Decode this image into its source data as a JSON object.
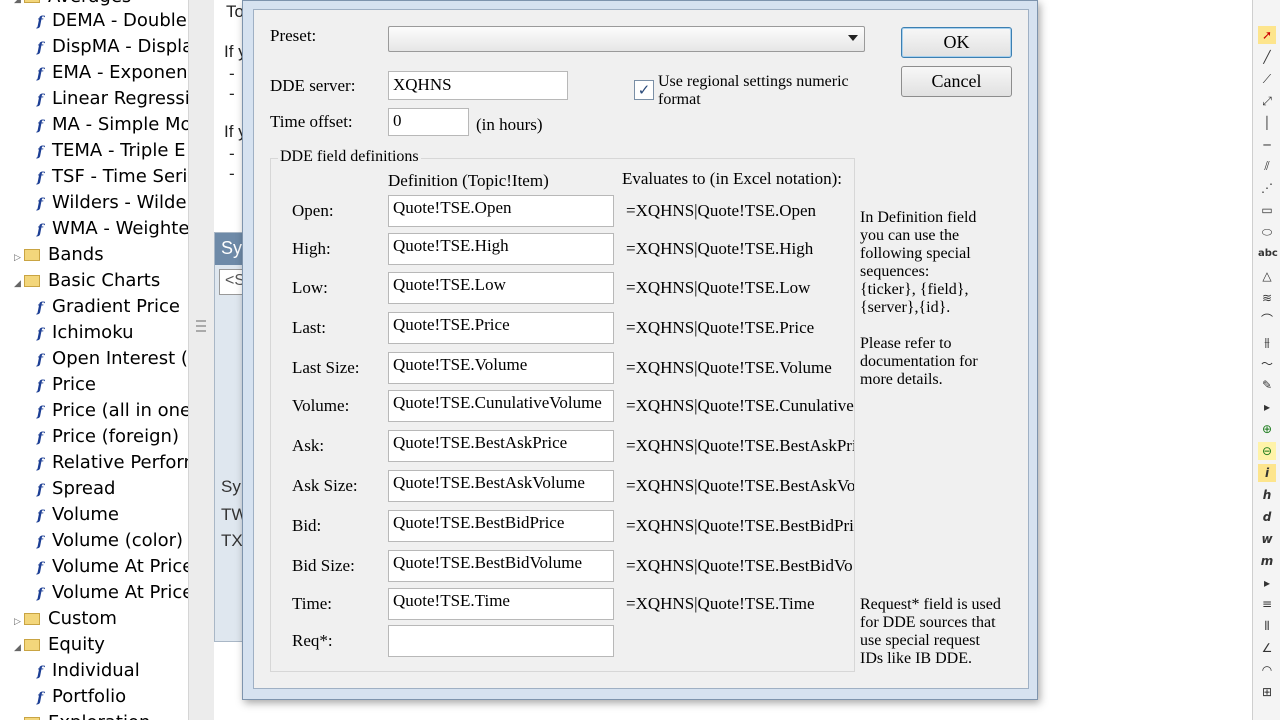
{
  "tree": {
    "top_partial_label": "Averages",
    "items": [
      {
        "kind": "item",
        "label": "DEMA - Double"
      },
      {
        "kind": "item",
        "label": "DispMA - Displa"
      },
      {
        "kind": "item",
        "label": "EMA - Exponent"
      },
      {
        "kind": "item",
        "label": "Linear Regressio"
      },
      {
        "kind": "item",
        "label": "MA - Simple Mo"
      },
      {
        "kind": "item",
        "label": "TEMA - Triple E"
      },
      {
        "kind": "item",
        "label": "TSF - Time Serie"
      },
      {
        "kind": "item",
        "label": "Wilders - Wilde"
      },
      {
        "kind": "item",
        "label": "WMA - Weighte"
      },
      {
        "kind": "folder",
        "label": "Bands",
        "expanded": false
      },
      {
        "kind": "folder",
        "label": "Basic Charts",
        "expanded": true
      },
      {
        "kind": "item",
        "label": "Gradient Price"
      },
      {
        "kind": "item",
        "label": "Ichimoku"
      },
      {
        "kind": "item",
        "label": "Open Interest (f"
      },
      {
        "kind": "item",
        "label": "Price"
      },
      {
        "kind": "item",
        "label": "Price (all in one"
      },
      {
        "kind": "item",
        "label": "Price (foreign)"
      },
      {
        "kind": "item",
        "label": "Relative Perforn"
      },
      {
        "kind": "item",
        "label": "Spread"
      },
      {
        "kind": "item",
        "label": "Volume"
      },
      {
        "kind": "item",
        "label": "Volume (color)"
      },
      {
        "kind": "item",
        "label": "Volume At Price"
      },
      {
        "kind": "item",
        "label": "Volume At Price"
      },
      {
        "kind": "folder",
        "label": "Custom",
        "expanded": false
      },
      {
        "kind": "folder",
        "label": "Equity",
        "expanded": true
      },
      {
        "kind": "item",
        "label": "Individual"
      },
      {
        "kind": "item",
        "label": "Portfolio"
      },
      {
        "kind": "folder",
        "label": "Exploration",
        "expanded": true
      }
    ]
  },
  "background": {
    "texts": [
      "To",
      "If y",
      "-",
      "-",
      "If y",
      "-",
      "-"
    ],
    "symbol_panel": {
      "header": "Syr",
      "input_placeholder": "<S",
      "rows": [
        "Sy",
        "TW",
        "TX"
      ]
    }
  },
  "dialog": {
    "preset_label": "Preset:",
    "preset_value": "",
    "ok_label": "OK",
    "cancel_label": "Cancel",
    "dde_server_label": "DDE server:",
    "dde_server_value": "XQHNS",
    "time_offset_label": "Time offset:",
    "time_offset_value": "0",
    "time_offset_unit": "(in hours)",
    "regional_checkbox_checked": true,
    "regional_checkbox_label_line1": "Use regional settings numeric",
    "regional_checkbox_label_line2": "format",
    "group_title": "DDE field definitions",
    "col_definition_header": "Definition (Topic!Item)",
    "col_evaluates_header": "Evaluates to (in Excel notation):",
    "fields": [
      {
        "label": "Open:",
        "definition": "Quote!TSE.Open",
        "evaluates": "=XQHNS|Quote!TSE.Open"
      },
      {
        "label": "High:",
        "definition": "Quote!TSE.High",
        "evaluates": "=XQHNS|Quote!TSE.High"
      },
      {
        "label": "Low:",
        "definition": "Quote!TSE.Low",
        "evaluates": "=XQHNS|Quote!TSE.Low"
      },
      {
        "label": "Last:",
        "definition": "Quote!TSE.Price",
        "evaluates": "=XQHNS|Quote!TSE.Price"
      },
      {
        "label": "Last Size:",
        "definition": "Quote!TSE.Volume",
        "evaluates": "=XQHNS|Quote!TSE.Volume"
      },
      {
        "label": "Volume:",
        "definition": "Quote!TSE.CunulativeVolume",
        "evaluates": "=XQHNS|Quote!TSE.Cunulative"
      },
      {
        "label": "Ask:",
        "definition": "Quote!TSE.BestAskPrice",
        "evaluates": "=XQHNS|Quote!TSE.BestAskPri"
      },
      {
        "label": "Ask Size:",
        "definition": "Quote!TSE.BestAskVolume",
        "evaluates": "=XQHNS|Quote!TSE.BestAskVo"
      },
      {
        "label": "Bid:",
        "definition": "Quote!TSE.BestBidPrice",
        "evaluates": "=XQHNS|Quote!TSE.BestBidPri"
      },
      {
        "label": "Bid Size:",
        "definition": "Quote!TSE.BestBidVolume",
        "evaluates": "=XQHNS|Quote!TSE.BestBidVo"
      },
      {
        "label": "Time:",
        "definition": "Quote!TSE.Time",
        "evaluates": "=XQHNS|Quote!TSE.Time"
      },
      {
        "label": "Req*:",
        "definition": "",
        "evaluates": ""
      }
    ],
    "note_definition": [
      "In Definition field",
      "you can use the",
      "following special",
      "sequences:",
      "{ticker}, {field},",
      "{server},{id}."
    ],
    "note_docs": [
      "Please refer to",
      "documentation for",
      "more details."
    ],
    "note_request": [
      "Request* field is used",
      "for DDE sources that",
      "use special request",
      "IDs like IB DDE."
    ]
  },
  "right_toolbar": {
    "tools": [
      "select-arrow",
      "line",
      "ray",
      "extended-line",
      "vertical-line",
      "horizontal-line",
      "parallel-lines",
      "fibonacci-fan",
      "rectangle",
      "ellipse",
      "text",
      "triangle",
      "gann-fan",
      "arc",
      "cycle-lines",
      "polyline",
      "pencil",
      "more",
      "zoom-in",
      "zoom-out",
      "info",
      "hourly",
      "daily",
      "weekly",
      "monthly",
      "more",
      "horizontal-grid",
      "vertical-grid",
      "angle",
      "arc-tool",
      "table"
    ],
    "text_tool_label": "abc",
    "info_label": "i",
    "period_labels": [
      "h",
      "d",
      "w",
      "m"
    ]
  }
}
